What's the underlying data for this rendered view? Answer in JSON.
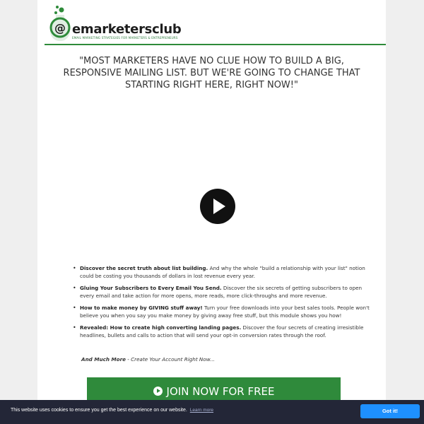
{
  "header": {
    "logo_text": "emarketersclub",
    "logo_tagline": "EMAIL MARKETING STRATEGIES FOR MARKETERS & ENTREPRENEURS"
  },
  "headline": "\"MOST MARKETERS HAVE NO CLUE HOW TO BUILD A BIG, RESPONSIVE MAILING LIST. BUT WE'RE GOING TO CHANGE THAT STARTING RIGHT HERE, RIGHT NOW!\"",
  "video": {
    "play_icon": "play-icon"
  },
  "bullets": [
    {
      "title": "Discover the secret truth about list building.",
      "body": " And why the whole \"build a relationship with your list\" notion could be costing you thousands of dollars in lost revenue every year."
    },
    {
      "title": "Gluing Your Subscribers to Every Email You Send.",
      "body": " Discover the six secrets of getting subscribers to open every email and take action for more opens, more reads, more click-throughs and more revenue."
    },
    {
      "title": "How to make money by GIVING stuff away!",
      "body": " Turn your free downloads into your best sales tools. People won't believe you when you say you make money by giving away free stuff, but this module shows you how!"
    },
    {
      "title": "Revealed: How to create high converting landing pages.",
      "body": " Discover the four secrets of creating irresistible headlines, bullets and calls to action that will send your opt-in conversion rates through the roof."
    }
  ],
  "more": {
    "bold": "And Much More",
    "rest": " - Create Your Account Right Now..."
  },
  "cta": {
    "label": "JOIN NOW FOR FREE",
    "color": "#2f8a3b"
  },
  "cookie": {
    "text": "This website uses cookies to ensure you get the best experience on our website.",
    "link": "Learn more",
    "button": "Got it!",
    "button_color": "#1e90ff"
  }
}
